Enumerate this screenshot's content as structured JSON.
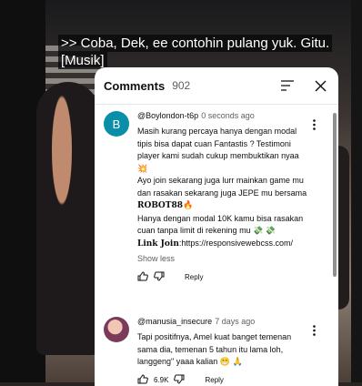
{
  "video": {
    "caption_line1": ">> Coba, Dek, ee contohin pulang yuk. Gitu.",
    "caption_line2": "[Musik]"
  },
  "panel": {
    "title": "Comments",
    "count": "902"
  },
  "comments": [
    {
      "avatar_letter": "B",
      "author": "@Boylondon-t6p",
      "time": "0 seconds ago",
      "lines": [
        "Masih kurang percaya hanya dengan modal tipis bisa dapat cuan Fantastis ? Testimoni player kami sudah cukup membuktikan nyaa 💥",
        "Ayo join sekarang juga lurr mainkan game mu dan rasakan sekarang juga JEPE mu bersama",
        "Hanya dengan modal 10K kamu bisa rasakan cuan tanpa limit di rekening mu 💸 💸"
      ],
      "brand": "𝐑𝐎𝐁𝐎𝐓𝟖𝟖🔥",
      "link_label": "𝐋𝐢𝐧𝐤 𝐉𝐨𝐢𝐧",
      "link_url": ":https://responsivewebcss.com/",
      "show_less": "Show less",
      "reply": "Reply"
    },
    {
      "author": "@manusia_insecure",
      "time": "7 days ago",
      "text": "Tapi positifnya, Amel kuat banget temenan sama dia, temenan 5 tahun itu lama loh, langgeng\" yaaa kalian 😁 🙏",
      "likes": "6.9K",
      "reply": "Reply"
    }
  ]
}
